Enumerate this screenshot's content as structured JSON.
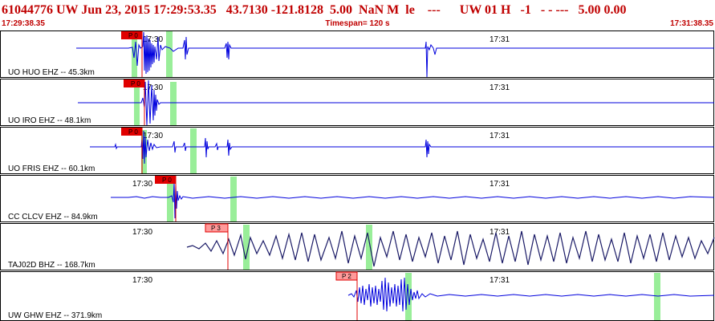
{
  "header": {
    "title": "61044776 UW Jun 23, 2015 17:29:53.35   43.7130 -121.8128  5.00  NaN M  le    ---      UW 01 H   -1   - - ---   5.00 0.00",
    "start_time": "17:29:38.35",
    "timespan": "Timespan= 120 s",
    "end_time": "17:31:38.35"
  },
  "colors": {
    "header_text": "#c00000",
    "trace": "#0000dd",
    "trace_dark": "#1a1a66",
    "pick_box": "#e00000",
    "pick_box_light": "#ff9a9a",
    "green_marker": "#99ee99",
    "panel_border": "#000000"
  },
  "panels": [
    {
      "label": "UO HUO EHZ --  45.3km",
      "time_labels": [
        "17:30",
        "17:31"
      ],
      "pick": "P 0",
      "pick_style": "solid"
    },
    {
      "label": "UO IRO EHZ --  48.1km",
      "time_labels": [
        "17:30",
        "17:31"
      ],
      "pick": "P 0",
      "pick_style": "solid"
    },
    {
      "label": "UO FRIS EHZ --  60.1km",
      "time_labels": [
        "17:30",
        "17:31"
      ],
      "pick": "P 0",
      "pick_style": "solid"
    },
    {
      "label": "CC CLCV EHZ --  84.9km",
      "time_labels": [
        "17:30",
        "17:31"
      ],
      "pick": "P 0",
      "pick_style": "solid"
    },
    {
      "label": "TAJ02D BHZ --  168.7km",
      "time_labels": [
        "17:30",
        "17:31"
      ],
      "pick": "P 3",
      "pick_style": "light"
    },
    {
      "label": "UW GHW EHZ --  371.9km",
      "time_labels": [
        "17:30",
        "17:31"
      ],
      "pick": "P 2",
      "pick_style": "light"
    }
  ]
}
